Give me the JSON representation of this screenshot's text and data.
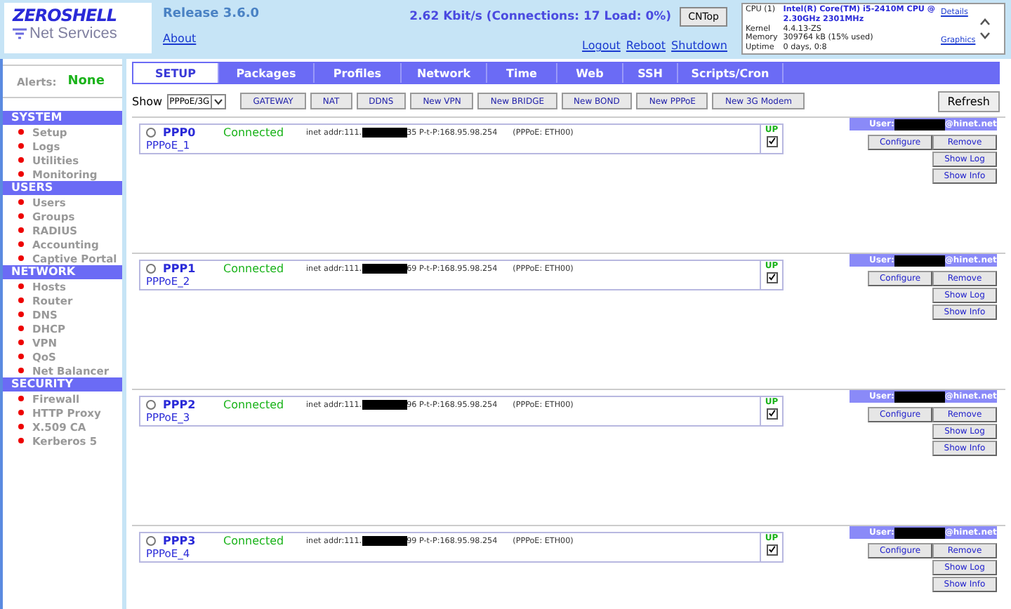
{
  "header": {
    "logo": {
      "title": "ZEROSHELL",
      "subtitle": "Net Services"
    },
    "release": "Release 3.6.0",
    "about": "About",
    "traffic": "2.62 Kbit/s (Connections: 17 Load: 0%)",
    "cntop": "CNTop",
    "links": [
      "Logout",
      "Reboot",
      "Shutdown"
    ],
    "sysinfo": {
      "rows": [
        {
          "label": "CPU (1)",
          "value": "Intel(R) Core(TM) i5-2410M CPU @ 2.30GHz 2301MHz",
          "kind": "highlight"
        },
        {
          "label": "Kernel",
          "value": "4.4.13-ZS",
          "kind": "plain"
        },
        {
          "label": "Memory",
          "value": "309764 kB  (15% used)",
          "kind": "plain"
        },
        {
          "label": "Uptime",
          "value": "0 days, 0:8",
          "kind": "plain"
        }
      ],
      "links": [
        "Details",
        "Graphics"
      ]
    }
  },
  "sidebar": {
    "alerts": {
      "label": "Alerts:",
      "value": "None"
    },
    "sections": [
      {
        "title": "SYSTEM",
        "items": [
          "Setup",
          "Logs",
          "Utilities",
          "Monitoring"
        ]
      },
      {
        "title": "USERS",
        "items": [
          "Users",
          "Groups",
          "RADIUS",
          "Accounting",
          "Captive Portal"
        ]
      },
      {
        "title": "NETWORK",
        "items": [
          "Hosts",
          "Router",
          "DNS",
          "DHCP",
          "VPN",
          "QoS",
          "Net Balancer"
        ]
      },
      {
        "title": "SECURITY",
        "items": [
          "Firewall",
          "HTTP Proxy",
          "X.509 CA",
          "Kerberos 5"
        ]
      }
    ]
  },
  "tabs": [
    {
      "label": "SETUP",
      "selected": true
    },
    {
      "label": "Packages",
      "selected": false
    },
    {
      "label": "Profiles",
      "selected": false
    },
    {
      "label": "Network",
      "selected": false
    },
    {
      "label": "Time",
      "selected": false
    },
    {
      "label": "Web",
      "selected": false
    },
    {
      "label": "SSH",
      "selected": false
    },
    {
      "label": "Scripts/Cron",
      "selected": false
    }
  ],
  "toolbar": {
    "show_label": "Show",
    "show_select": "PPPoE/3G",
    "buttons": [
      "GATEWAY",
      "NAT",
      "DDNS",
      "New VPN",
      "New BRIDGE",
      "New BOND",
      "New PPPoE",
      "New 3G Modem"
    ],
    "refresh": "Refresh"
  },
  "entries": [
    {
      "selected": false,
      "name": "PPP0",
      "status": "Connected",
      "addr_prefix": "inet addr:111.",
      "addr_suffix": "35 P-t-P:168.95.98.254",
      "interface": "(PPPoE: ETH00)",
      "description": "PPPoE_1",
      "up_label": "UP",
      "up": true,
      "user_prefix": "User:",
      "user_suffix": "@hinet.net",
      "buttons": [
        "Configure",
        "Remove",
        "Show Log",
        "Show Info"
      ]
    },
    {
      "selected": false,
      "name": "PPP1",
      "status": "Connected",
      "addr_prefix": "inet addr:111.",
      "addr_suffix": "69 P-t-P:168.95.98.254",
      "interface": "(PPPoE: ETH00)",
      "description": "PPPoE_2",
      "up_label": "UP",
      "up": true,
      "user_prefix": "User:",
      "user_suffix": "@hinet.net",
      "buttons": [
        "Configure",
        "Remove",
        "Show Log",
        "Show Info"
      ]
    },
    {
      "selected": false,
      "name": "PPP2",
      "status": "Connected",
      "addr_prefix": "inet addr:111.",
      "addr_suffix": "96 P-t-P:168.95.98.254",
      "interface": "(PPPoE: ETH00)",
      "description": "PPPoE_3",
      "up_label": "UP",
      "up": true,
      "user_prefix": "User:",
      "user_suffix": "@hinet.net",
      "buttons": [
        "Configure",
        "Remove",
        "Show Log",
        "Show Info"
      ]
    },
    {
      "selected": false,
      "name": "PPP3",
      "status": "Connected",
      "addr_prefix": "inet addr:111.",
      "addr_suffix": "99 P-t-P:168.95.98.254",
      "interface": "(PPPoE: ETH00)",
      "description": "PPPoE_4",
      "up_label": "UP",
      "up": true,
      "user_prefix": "User:",
      "user_suffix": "@hinet.net",
      "buttons": [
        "Configure",
        "Remove",
        "Show Log",
        "Show Info"
      ]
    }
  ]
}
